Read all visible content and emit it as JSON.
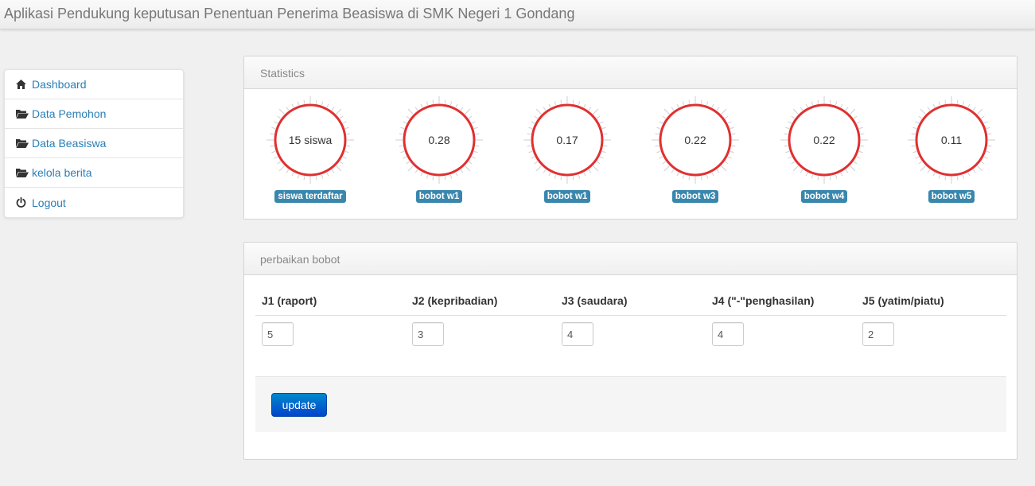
{
  "app": {
    "title": "Aplikasi Pendukung keputusan Penentuan Penerima Beasiswa di SMK Negeri 1 Gondang"
  },
  "sidebar": {
    "items": [
      {
        "label": "Dashboard",
        "icon": "home-icon"
      },
      {
        "label": "Data Pemohon",
        "icon": "folder-open-icon"
      },
      {
        "label": "Data Beasiswa",
        "icon": "folder-open-icon"
      },
      {
        "label": "kelola berita",
        "icon": "folder-open-icon"
      },
      {
        "label": "Logout",
        "icon": "power-icon"
      }
    ],
    "link_color": "#2a7fb8"
  },
  "stats": {
    "title": "Statistics",
    "ring_color": "#e03030",
    "badge_color": "#3a87ad",
    "gauges": [
      {
        "value": "15 siswa",
        "label": "siswa terdaftar"
      },
      {
        "value": "0.28",
        "label": "bobot w1"
      },
      {
        "value": "0.17",
        "label": "bobot w1"
      },
      {
        "value": "0.22",
        "label": "bobot w3"
      },
      {
        "value": "0.22",
        "label": "bobot w4"
      },
      {
        "value": "0.11",
        "label": "bobot w5"
      }
    ]
  },
  "bobot": {
    "title": "perbaikan bobot",
    "columns": [
      {
        "header": "J1 (raport)",
        "value": "5"
      },
      {
        "header": "J2 (kepribadian)",
        "value": "3"
      },
      {
        "header": "J3 (saudara)",
        "value": "4"
      },
      {
        "header": "J4 (\"-\"penghasilan)",
        "value": "4"
      },
      {
        "header": "J5 (yatim/piatu)",
        "value": "2"
      }
    ],
    "update_label": "update",
    "button_color": "#0055cc"
  }
}
